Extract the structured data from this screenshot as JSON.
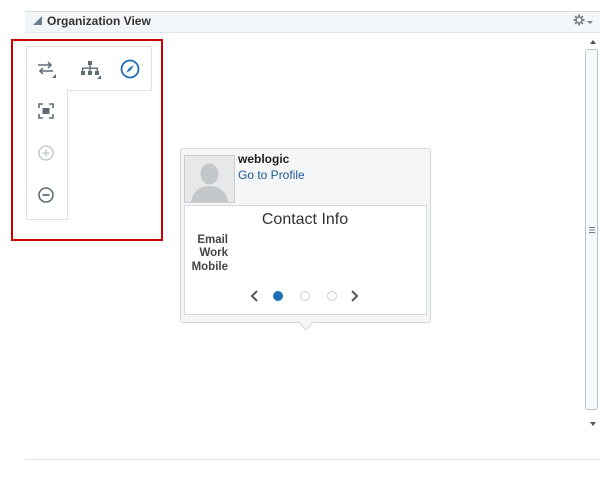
{
  "header": {
    "title": "Organization View"
  },
  "toolbar": {
    "tools": [
      "switch-layout-icon",
      "hierarchy-icon",
      "compass-icon",
      "fit-to-screen-icon",
      "zoom-in-icon",
      "zoom-out-icon"
    ]
  },
  "card": {
    "username": "weblogic",
    "profile_link": "Go to Profile",
    "contact_title": "Contact Info",
    "fields": [
      "Email",
      "Work",
      "Mobile"
    ],
    "pager": {
      "pages": 3,
      "current": 1
    }
  },
  "colors": {
    "selection_box": "#cc0000",
    "accent": "#1f6fb6",
    "link": "#1f5a95"
  }
}
